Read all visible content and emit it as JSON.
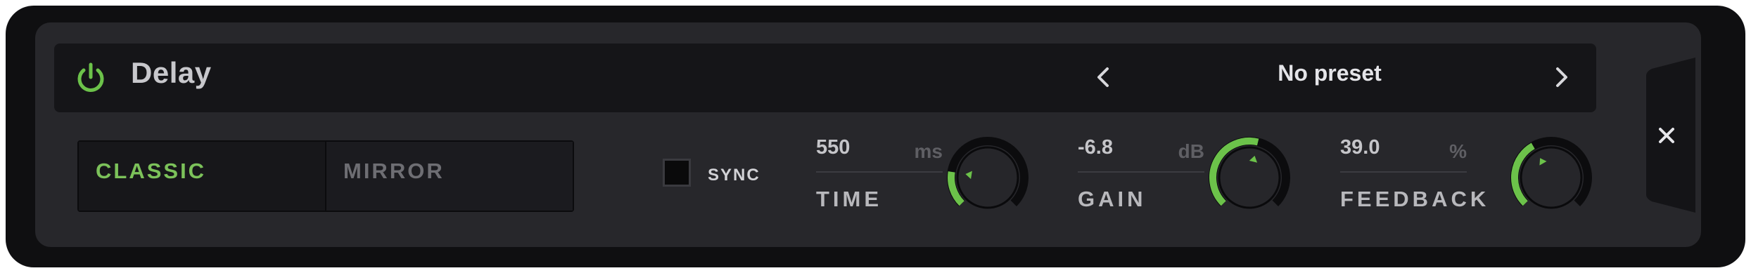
{
  "plugin": {
    "name": "Delay",
    "enabled": true,
    "accent_color": "#6cc24a"
  },
  "preset": {
    "label": "No preset",
    "prev_icon": "chevron-left-icon",
    "next_icon": "chevron-right-icon"
  },
  "modes": {
    "items": [
      {
        "label": "CLASSIC",
        "active": true
      },
      {
        "label": "MIRROR",
        "active": false
      }
    ]
  },
  "sync": {
    "label": "SYNC",
    "checked": false
  },
  "params": [
    {
      "id": "time",
      "value": "550",
      "unit": "ms",
      "name": "TIME",
      "knob_level": 0.2
    },
    {
      "id": "gain",
      "value": "-6.8",
      "unit": "dB",
      "name": "GAIN",
      "knob_level": 0.55
    },
    {
      "id": "feedback",
      "value": "39.0",
      "unit": "%",
      "name": "FEEDBACK",
      "knob_level": 0.39
    }
  ],
  "close": {
    "icon": "close-icon"
  }
}
